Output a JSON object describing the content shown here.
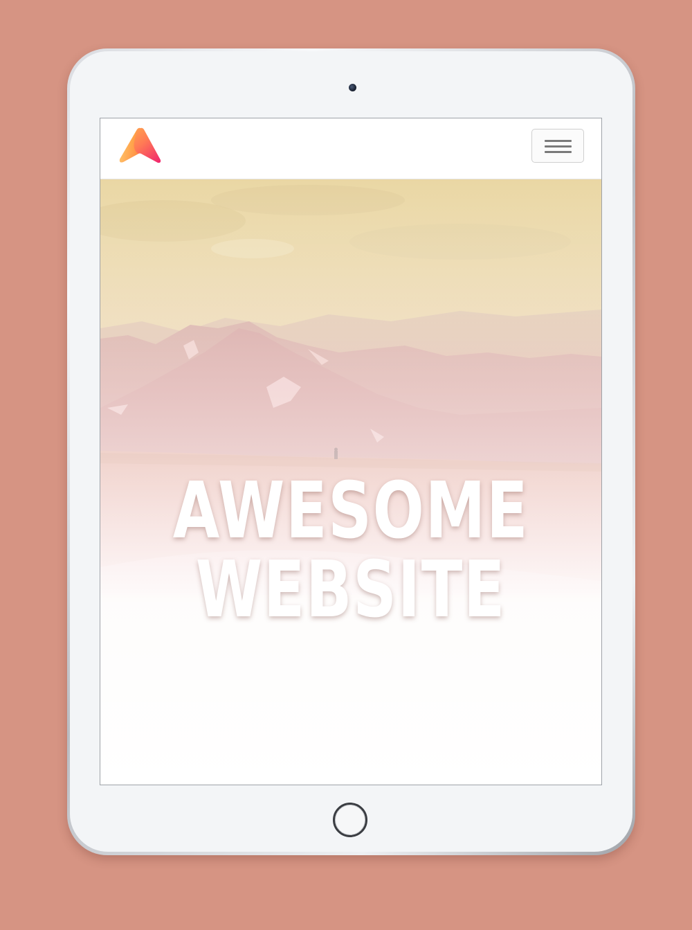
{
  "colors": {
    "background": "#d69483",
    "screen": "#ffffff",
    "hero_text": "#ffffff"
  },
  "navbar": {
    "logo_icon": "triangle-gradient-logo",
    "menu_icon": "hamburger-menu-icon"
  },
  "hero": {
    "title_line1": "AWESOME",
    "title_line2": "WEBSITE"
  },
  "device": {
    "camera_icon": "front-camera",
    "home_button_icon": "home-button"
  }
}
